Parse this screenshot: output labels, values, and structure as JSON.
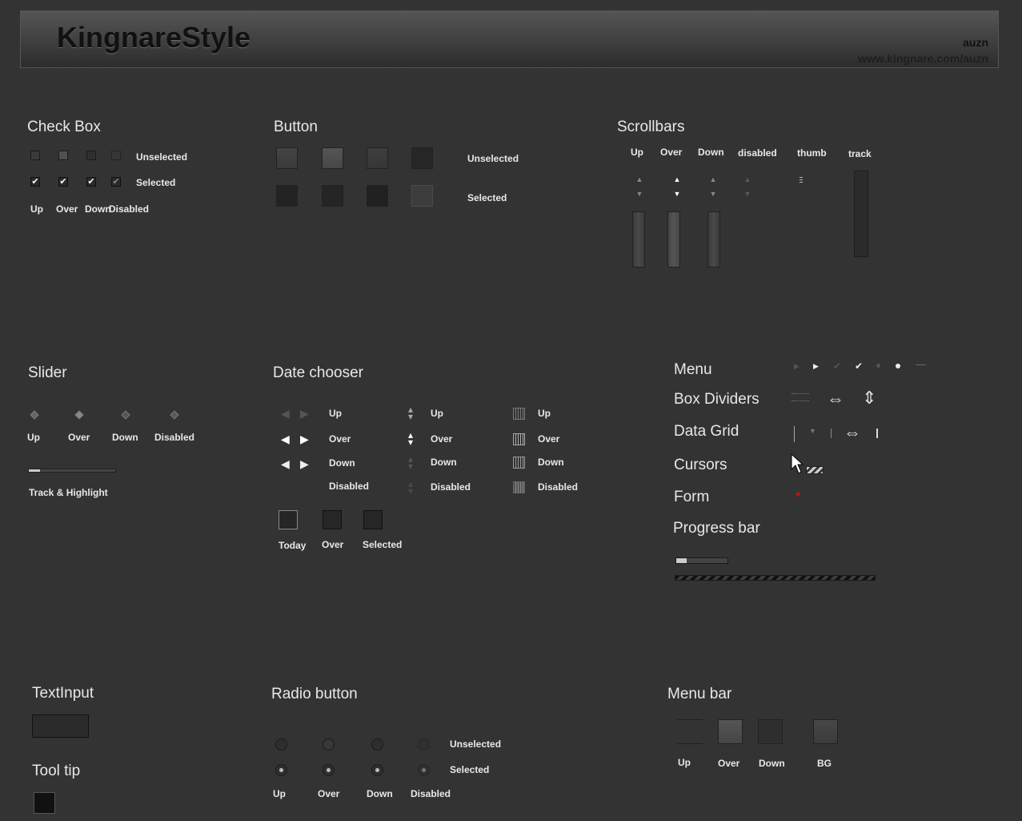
{
  "header": {
    "title": "KingnareStyle",
    "author": "auzn",
    "site": "www.kingnare.com/auzn"
  },
  "checkbox": {
    "title": "Check Box",
    "unselected": "Unselected",
    "selected": "Selected",
    "states": [
      "Up",
      "Over",
      "Down",
      "Disabled"
    ]
  },
  "button": {
    "title": "Button",
    "unselected": "Unselected",
    "selected": "Selected"
  },
  "scrollbars": {
    "title": "Scrollbars",
    "states": [
      "Up",
      "Over",
      "Down",
      "disabled",
      "thumb",
      "track"
    ]
  },
  "slider": {
    "title": "Slider",
    "states": [
      "Up",
      "Over",
      "Down",
      "Disabled"
    ],
    "track_label": "Track & Highlight"
  },
  "datechooser": {
    "title": "Date chooser",
    "states": [
      "Up",
      "Over",
      "Down",
      "Disabled"
    ],
    "days": [
      "Today",
      "Over",
      "Selected"
    ]
  },
  "right": {
    "menu": "Menu",
    "box_dividers": "Box Dividers",
    "data_grid": "Data Grid",
    "cursors": "Cursors",
    "form": "Form",
    "form_required_mark": "*",
    "progress_bar": "Progress bar",
    "progress": 0.2
  },
  "textinput": {
    "title": "TextInput"
  },
  "tooltip": {
    "title": "Tool tip"
  },
  "radio": {
    "title": "Radio button",
    "unselected": "Unselected",
    "selected": "Selected",
    "states": [
      "Up",
      "Over",
      "Down",
      "Disabled"
    ]
  },
  "menubar": {
    "title": "Menu bar",
    "states": [
      "Up",
      "Over",
      "Down",
      "BG"
    ]
  }
}
